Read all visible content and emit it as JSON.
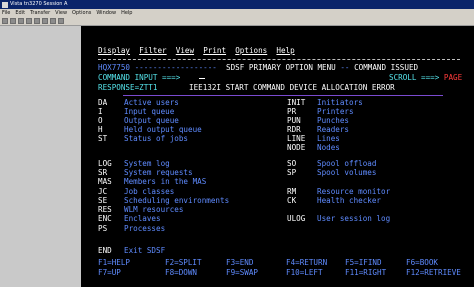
{
  "window": {
    "title": "Vista tn3270 Session A"
  },
  "menubar": [
    "File",
    "Edit",
    "Transfer",
    "View",
    "Options",
    "Window",
    "Help"
  ],
  "panel": {
    "actions": [
      "Display",
      "Filter",
      "View",
      "Print",
      "Options",
      "Help"
    ],
    "header_left": "HQX7750 ------------------",
    "header_title": "SDSF PRIMARY OPTION MENU",
    "header_sep": "--",
    "header_msg": "COMMAND ISSUED",
    "command_label": "COMMAND INPUT ===>",
    "scroll_label": "SCROLL ===>",
    "scroll_value": "PAGE",
    "response_label": "RESPONSE=ZTT1",
    "response_text": "IEE132I START COMMAND DEVICE ALLOCATION ERROR"
  },
  "options_left": [
    {
      "code": "DA",
      "desc": "Active users"
    },
    {
      "code": "I",
      "desc": "Input queue"
    },
    {
      "code": "O",
      "desc": "Output queue"
    },
    {
      "code": "H",
      "desc": "Held output queue"
    },
    {
      "code": "ST",
      "desc": "Status of jobs"
    },
    {
      "code": "LOG",
      "desc": "System log"
    },
    {
      "code": "SR",
      "desc": "System requests"
    },
    {
      "code": "MAS",
      "desc": "Members in the MAS"
    },
    {
      "code": "JC",
      "desc": "Job classes"
    },
    {
      "code": "SE",
      "desc": "Scheduling environments"
    },
    {
      "code": "RES",
      "desc": "WLM resources"
    },
    {
      "code": "ENC",
      "desc": "Enclaves"
    },
    {
      "code": "PS",
      "desc": "Processes"
    },
    {
      "code": "END",
      "desc": "Exit SDSF"
    }
  ],
  "options_right": [
    {
      "code": "INIT",
      "desc": "Initiators"
    },
    {
      "code": "PR",
      "desc": "Printers"
    },
    {
      "code": "PUN",
      "desc": "Punches"
    },
    {
      "code": "RDR",
      "desc": "Readers"
    },
    {
      "code": "LINE",
      "desc": "Lines"
    },
    {
      "code": "NODE",
      "desc": "Nodes"
    },
    {
      "code": "SO",
      "desc": "Spool offload"
    },
    {
      "code": "SP",
      "desc": "Spool volumes"
    },
    {
      "code": "RM",
      "desc": "Resource monitor"
    },
    {
      "code": "CK",
      "desc": "Health checker"
    },
    {
      "code": "ULOG",
      "desc": "User session log"
    }
  ],
  "pfkeys": [
    [
      "F1=HELP",
      "F2=SPLIT",
      "F3=END",
      "F4=RETURN",
      "F5=IFIND",
      "F6=BOOK"
    ],
    [
      "F7=UP",
      "F8=DOWN",
      "F9=SWAP",
      "F10=LEFT",
      "F11=RIGHT",
      "F12=RETRIEVE"
    ]
  ],
  "colors": {
    "field": "#5f8bff",
    "highlight": "#55e3ea",
    "text": "#ffffff",
    "alert": "#ff3b3b",
    "terminal_bg": "#000000"
  }
}
